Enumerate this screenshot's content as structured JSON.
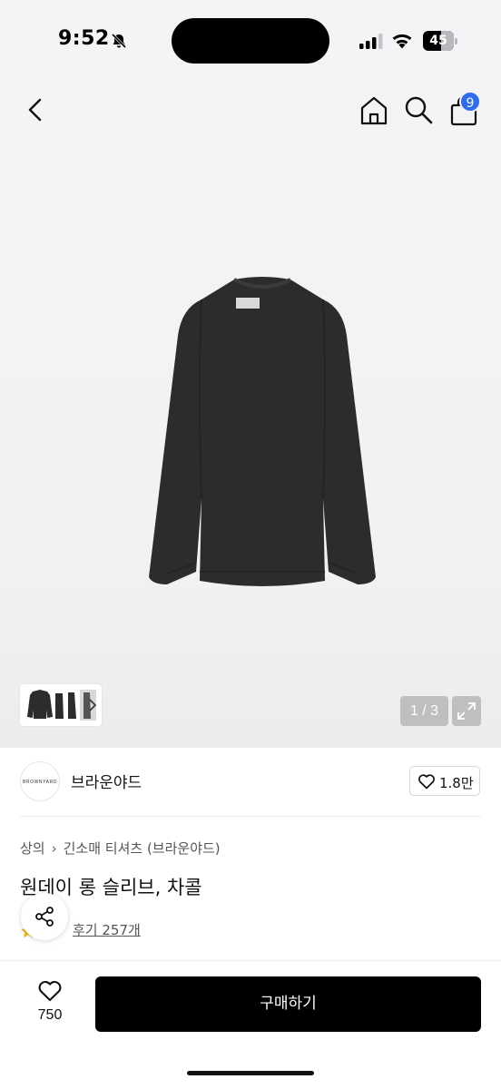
{
  "status_bar": {
    "time": "9:52",
    "battery": "45",
    "icons": [
      "bell-muted-icon",
      "cellular-signal-icon",
      "wifi-icon",
      "battery-icon"
    ]
  },
  "top_nav": {
    "icons": [
      "back-arrow-icon",
      "home-icon",
      "search-icon",
      "cart-icon"
    ],
    "cart_badge": "9"
  },
  "gallery": {
    "pager": "1 / 3",
    "thumbnail_more_icon": "chevron-right-icon",
    "expand_icon": "expand-icon",
    "product_color": "#2b2c2e"
  },
  "brand": {
    "logo_text": "BROWNYARD",
    "name": "브라운야드",
    "like_count": "1.8만"
  },
  "breadcrumb": [
    "상의",
    "긴소매 티셔츠 (브라운야드)"
  ],
  "product": {
    "title": "원데이 롱 슬리브, 차콜",
    "reviews": "후기 257개"
  },
  "bottom_bar": {
    "like_count": "750",
    "buy_label": "구매하기"
  },
  "colors": {
    "accent_badge": "#2f6bf0",
    "buy_button": "#000000",
    "hero_background": "#f4f4f6"
  }
}
